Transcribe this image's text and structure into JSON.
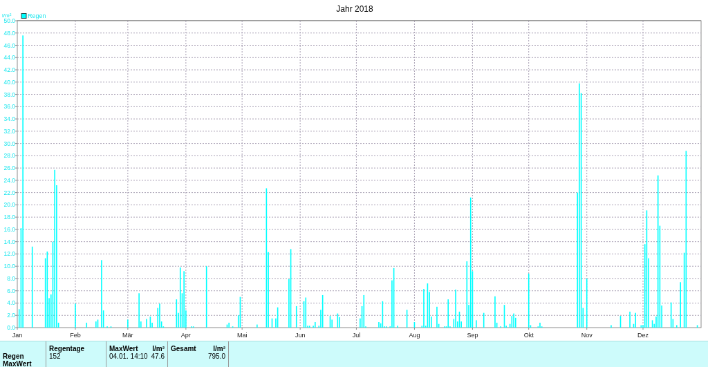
{
  "chart": {
    "chart_data": {
      "type": "bar",
      "title": "Jahr 2018",
      "ylabel": "l/m²",
      "ylim": [
        0,
        50
      ],
      "grid": true,
      "categories": [
        "Jan",
        null,
        null,
        null,
        null,
        null,
        null,
        null,
        null,
        null,
        null,
        null,
        null,
        null,
        null,
        null,
        null,
        null,
        null,
        null,
        null,
        null,
        null,
        null,
        null,
        null,
        null,
        null,
        null,
        null,
        null,
        "Feb",
        null,
        null,
        null,
        null,
        null,
        null,
        null,
        null,
        null,
        null,
        null,
        null,
        null,
        null,
        null,
        null,
        null,
        null,
        null,
        null,
        null,
        null,
        null,
        null,
        null,
        null,
        null,
        "Mär",
        null,
        null,
        null,
        null,
        null,
        null,
        null,
        null,
        null,
        null,
        null,
        null,
        null,
        null,
        null,
        null,
        null,
        null,
        null,
        null,
        null,
        null,
        null,
        null,
        null,
        null,
        null,
        null,
        null,
        null,
        "Apr",
        null,
        null,
        null,
        null,
        null,
        null,
        null,
        null,
        null,
        null,
        null,
        null,
        null,
        null,
        null,
        null,
        null,
        null,
        null,
        null,
        null,
        null,
        null,
        null,
        null,
        null,
        null,
        null,
        null,
        "Mai",
        null,
        null,
        null,
        null,
        null,
        null,
        null,
        null,
        null,
        null,
        null,
        null,
        null,
        null,
        null,
        null,
        null,
        null,
        null,
        null,
        null,
        null,
        null,
        null,
        null,
        null,
        null,
        null,
        null,
        null,
        "Jun",
        null,
        null,
        null,
        null,
        null,
        null,
        null,
        null,
        null,
        null,
        null,
        null,
        null,
        null,
        null,
        null,
        null,
        null,
        null,
        null,
        null,
        null,
        null,
        null,
        null,
        null,
        null,
        null,
        null,
        "Jul",
        null,
        null,
        null,
        null,
        null,
        null,
        null,
        null,
        null,
        null,
        null,
        null,
        null,
        null,
        null,
        null,
        null,
        null,
        null,
        null,
        null,
        null,
        null,
        null,
        null,
        null,
        null,
        null,
        null,
        null,
        "Aug",
        null,
        null,
        null,
        null,
        null,
        null,
        null,
        null,
        null,
        null,
        null,
        null,
        null,
        null,
        null,
        null,
        null,
        null,
        null,
        null,
        null,
        null,
        null,
        null,
        null,
        null,
        null,
        null,
        null,
        null,
        "Sep",
        null,
        null,
        null,
        null,
        null,
        null,
        null,
        null,
        null,
        null,
        null,
        null,
        null,
        null,
        null,
        null,
        null,
        null,
        null,
        null,
        null,
        null,
        null,
        null,
        null,
        null,
        null,
        null,
        null,
        "Okt",
        null,
        null,
        null,
        null,
        null,
        null,
        null,
        null,
        null,
        null,
        null,
        null,
        null,
        null,
        null,
        null,
        null,
        null,
        null,
        null,
        null,
        null,
        null,
        null,
        null,
        null,
        null,
        null,
        null,
        null,
        "Nov",
        null,
        null,
        null,
        null,
        null,
        null,
        null,
        null,
        null,
        null,
        null,
        null,
        null,
        null,
        null,
        null,
        null,
        null,
        null,
        null,
        null,
        null,
        null,
        null,
        null,
        null,
        null,
        null,
        null,
        "Dez",
        null,
        null,
        null,
        null,
        null,
        null,
        null,
        null,
        null,
        null,
        null,
        null,
        null,
        null,
        null,
        null,
        null,
        null,
        null,
        null,
        null,
        null,
        null,
        null,
        null,
        null,
        null,
        null,
        null,
        null
      ],
      "series": [
        {
          "name": "Regen",
          "color": "#00ffff",
          "values": [
            null,
            3.0,
            16.2,
            47.6,
            null,
            null,
            null,
            null,
            13.2,
            null,
            null,
            null,
            null,
            null,
            null,
            11.3,
            12.4,
            4.8,
            5.4,
            14.0,
            25.7,
            23.2,
            0.8,
            null,
            null,
            null,
            null,
            null,
            null,
            null,
            null,
            3.9,
            null,
            null,
            null,
            null,
            null,
            0.8,
            null,
            null,
            null,
            null,
            1.0,
            1.3,
            null,
            11.0,
            2.8,
            null,
            0.2,
            null,
            0.2,
            null,
            null,
            null,
            null,
            null,
            null,
            null,
            null,
            1.3,
            null,
            null,
            null,
            null,
            null,
            5.6,
            1.0,
            null,
            null,
            1.4,
            null,
            1.8,
            0.8,
            null,
            null,
            3.2,
            3.9,
            1.0,
            0.2,
            null,
            null,
            null,
            null,
            null,
            null,
            4.6,
            2.4,
            9.8,
            5.6,
            9.2,
            2.8,
            null,
            null,
            0.2,
            0.2,
            null,
            null,
            null,
            null,
            null,
            null,
            10.0,
            null,
            null,
            null,
            null,
            null,
            null,
            null,
            null,
            null,
            null,
            0.5,
            0.8,
            null,
            0.2,
            null,
            null,
            2.0,
            5.0,
            null,
            null,
            null,
            null,
            null,
            null,
            null,
            null,
            0.5,
            null,
            null,
            null,
            null,
            22.7,
            12.3,
            null,
            1.5,
            null,
            1.5,
            3.3,
            null,
            null,
            null,
            null,
            null,
            7.9,
            12.8,
            null,
            null,
            3.5,
            null,
            null,
            null,
            4.3,
            4.9,
            0.3,
            0.3,
            null,
            0.3,
            0.9,
            null,
            0.3,
            2.9,
            5.3,
            null,
            null,
            null,
            1.9,
            1.3,
            null,
            null,
            2.3,
            1.7,
            null,
            null,
            null,
            null,
            null,
            null,
            null,
            null,
            null,
            null,
            1.5,
            3.5,
            5.3,
            0.2,
            null,
            null,
            null,
            null,
            null,
            null,
            0.9,
            0.7,
            4.3,
            0.2,
            0.2,
            null,
            0.2,
            7.7,
            9.7,
            null,
            0.3,
            null,
            null,
            null,
            null,
            2.9,
            null,
            null,
            null,
            0.9,
            null,
            null,
            null,
            0.3,
            6.3,
            0.3,
            7.2,
            5.8,
            1.8,
            null,
            null,
            3.4,
            0.6,
            null,
            null,
            0.2,
            0.2,
            4.6,
            0.2,
            null,
            1.4,
            6.2,
            1.0,
            2.6,
            1.0,
            null,
            null,
            10.8,
            3.7,
            21.2,
            9.2,
            null,
            1.2,
            null,
            null,
            null,
            2.4,
            null,
            null,
            null,
            null,
            null,
            5.1,
            0.8,
            null,
            0.2,
            null,
            3.7,
            0.3,
            null,
            0.6,
            1.9,
            2.3,
            1.6,
            null,
            null,
            null,
            null,
            null,
            null,
            8.8,
            0.4,
            null,
            null,
            null,
            0.2,
            0.8,
            0.2,
            null,
            null,
            null,
            null,
            null,
            null,
            null,
            null,
            null,
            null,
            null,
            null,
            null,
            null,
            null,
            null,
            null,
            null,
            22.0,
            39.8,
            38.2,
            3.2,
            null,
            8.0,
            null,
            null,
            null,
            null,
            null,
            null,
            null,
            null,
            null,
            null,
            null,
            null,
            0.4,
            null,
            null,
            null,
            null,
            1.9,
            null,
            null,
            null,
            null,
            2.6,
            null,
            0.6,
            2.4,
            null,
            null,
            0.4,
            0.4,
            13.6,
            19.1,
            11.3,
            null,
            1.2,
            0.6,
            1.8,
            24.8,
            16.6,
            3.6,
            null,
            null,
            null,
            null,
            4.1,
            1.4,
            null,
            0.4,
            null,
            7.4,
            null,
            12.2,
            28.8,
            null,
            null,
            null,
            null,
            null,
            0.4,
            null
          ]
        }
      ],
      "yticks": [
        {
          "value": 0,
          "label": "0.0"
        },
        {
          "value": 2,
          "label": "2.0"
        },
        {
          "value": 4,
          "label": "4.0"
        },
        {
          "value": 6,
          "label": "6.0"
        },
        {
          "value": 8,
          "label": "8.0"
        },
        {
          "value": 10,
          "label": "10.0"
        },
        {
          "value": 12,
          "label": "12.0"
        },
        {
          "value": 14,
          "label": "14.0"
        },
        {
          "value": 16,
          "label": "16.0"
        },
        {
          "value": 18,
          "label": "18.0"
        },
        {
          "value": 20,
          "label": "20.0"
        },
        {
          "value": 22,
          "label": "22.0"
        },
        {
          "value": 24,
          "label": "24.0"
        },
        {
          "value": 26,
          "label": "26.0"
        },
        {
          "value": 28,
          "label": "28.0"
        },
        {
          "value": 30,
          "label": "30.0"
        },
        {
          "value": 32,
          "label": "32.0"
        },
        {
          "value": 34,
          "label": "34.0"
        },
        {
          "value": 36,
          "label": "36.0"
        },
        {
          "value": 38,
          "label": "38.0"
        },
        {
          "value": 40,
          "label": "40.0"
        },
        {
          "value": 42,
          "label": "42.0"
        },
        {
          "value": 44,
          "label": "44.0"
        },
        {
          "value": 46,
          "label": "46.0"
        },
        {
          "value": 48,
          "label": "48.0"
        },
        {
          "value": 50,
          "label": "50.0"
        }
      ]
    }
  },
  "summary_table": {
    "headers": {
      "regentage": "Regentage",
      "maxwert": "MaxWert",
      "maxwert_unit": "l/m²",
      "gesamt": "Gesamt",
      "gesamt_unit": "l/m²"
    },
    "rows": [
      {
        "label": "Regen",
        "regentage": "152",
        "maxwert_time": "04.01. 14:10",
        "maxwert": "47.6",
        "gesamt": "795.0"
      },
      {
        "label": "MaxWert"
      }
    ]
  }
}
